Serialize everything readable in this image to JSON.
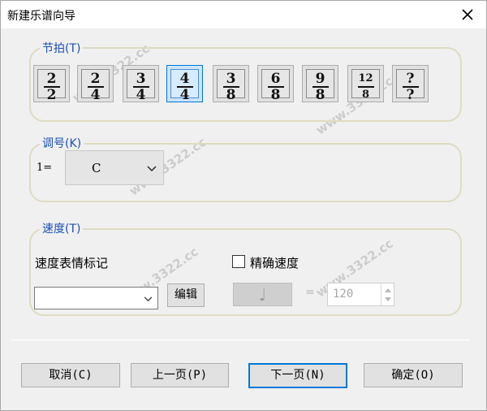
{
  "window": {
    "title": "新建乐谱向导"
  },
  "meter": {
    "legend": "节拍(T)",
    "options": [
      {
        "top": "2",
        "bottom": "2"
      },
      {
        "top": "2",
        "bottom": "4"
      },
      {
        "top": "3",
        "bottom": "4"
      },
      {
        "top": "4",
        "bottom": "4"
      },
      {
        "top": "3",
        "bottom": "8"
      },
      {
        "top": "6",
        "bottom": "8"
      },
      {
        "top": "9",
        "bottom": "8"
      },
      {
        "top": "12",
        "bottom": "8"
      },
      {
        "top": "?",
        "bottom": "?"
      }
    ],
    "selected": "4/4"
  },
  "key": {
    "legend": "调号(K)",
    "prefix": "1=",
    "value": "C"
  },
  "tempo": {
    "legend": "速度(T)",
    "expression_label": "速度表情标记",
    "expression_value": "",
    "edit_button": "编辑",
    "exact_label": "精确速度",
    "exact_checked": false,
    "note_glyph": "♩",
    "equals": "=",
    "bpm": "120"
  },
  "buttons": {
    "cancel": "取消(C)",
    "prev": "上一页(P)",
    "next": "下一页(N)",
    "ok": "确定(O)"
  },
  "watermark": "www.3322.cc"
}
